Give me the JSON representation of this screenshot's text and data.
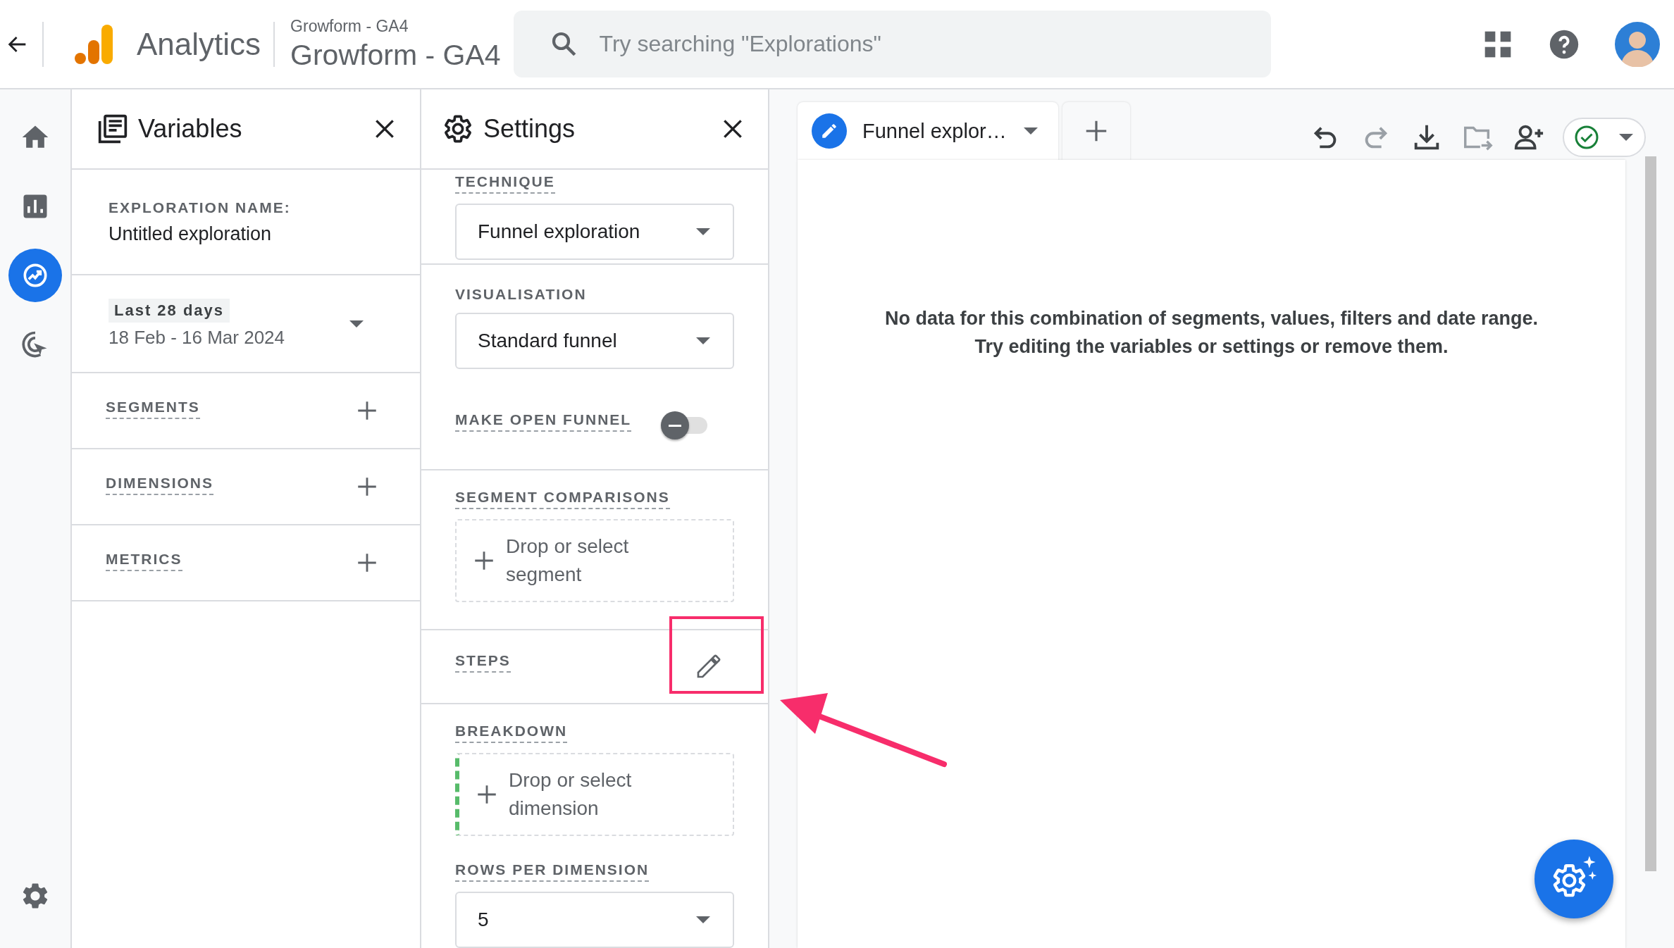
{
  "header": {
    "product": "Analytics",
    "account": "Growform - GA4",
    "property": "Growform - GA4",
    "search": {
      "placeholder": "Try searching \"Explorations\""
    }
  },
  "nav": [
    {
      "kind": "home",
      "selected": false
    },
    {
      "kind": "reports",
      "selected": false
    },
    {
      "kind": "explore",
      "selected": true
    },
    {
      "kind": "advertising",
      "selected": false
    }
  ],
  "variables": {
    "title": "Variables",
    "name_label": "EXPLORATION NAME:",
    "name": "Untitled exploration",
    "date_preset": "Last 28 days",
    "date_range": "18 Feb - 16 Mar 2024",
    "sections": [
      {
        "label": "SEGMENTS"
      },
      {
        "label": "DIMENSIONS"
      },
      {
        "label": "METRICS"
      }
    ]
  },
  "settings": {
    "title": "Settings",
    "technique": {
      "label": "TECHNIQUE",
      "value": "Funnel exploration"
    },
    "visualisation": {
      "label": "VISUALISATION",
      "value": "Standard funnel"
    },
    "open_funnel": {
      "label": "MAKE OPEN FUNNEL",
      "on": false
    },
    "segment_comparisons": {
      "label": "SEGMENT COMPARISONS",
      "drop": "Drop or select segment"
    },
    "steps": {
      "label": "STEPS"
    },
    "breakdown": {
      "label": "BREAKDOWN",
      "drop": "Drop or select dimension"
    },
    "rows_per_dimension": {
      "label": "ROWS PER DIMENSION",
      "value": "5"
    }
  },
  "canvas": {
    "tabs": [
      {
        "label": "Funnel explor…",
        "selected": true
      }
    ],
    "message": [
      "No data for this combination of segments, values, filters and date range.",
      "Try editing the variables or settings or remove them."
    ]
  }
}
